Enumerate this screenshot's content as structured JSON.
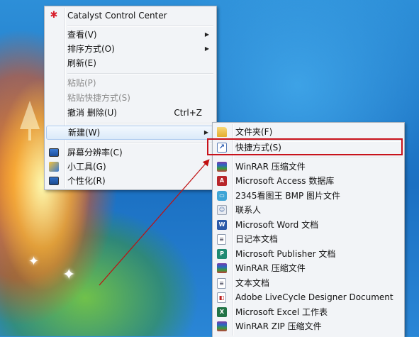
{
  "context_menu": {
    "items": [
      {
        "label": "Catalyst Control Center",
        "icon": "catalyst-icon"
      },
      {
        "label": "查看(V)",
        "submenu": true
      },
      {
        "label": "排序方式(O)",
        "submenu": true
      },
      {
        "label": "刷新(E)"
      },
      {
        "label": "粘贴(P)",
        "disabled": true
      },
      {
        "label": "粘贴快捷方式(S)",
        "disabled": true
      },
      {
        "label": "撤消 删除(U)",
        "shortcut": "Ctrl+Z"
      },
      {
        "label": "新建(W)",
        "submenu": true,
        "active": true
      },
      {
        "label": "屏幕分辨率(C)",
        "icon": "screen-resolution-icon"
      },
      {
        "label": "小工具(G)",
        "icon": "gadgets-icon"
      },
      {
        "label": "个性化(R)",
        "icon": "personalize-icon"
      }
    ]
  },
  "new_submenu": {
    "items": [
      {
        "label": "文件夹(F)",
        "icon": "folder-icon"
      },
      {
        "label": "快捷方式(S)",
        "icon": "shortcut-icon"
      },
      {
        "label": "WinRAR 压缩文件",
        "icon": "winrar-icon"
      },
      {
        "label": "Microsoft Access 数据库",
        "icon": "access-icon"
      },
      {
        "label": "2345看图王 BMP 图片文件",
        "icon": "bmp-image-icon"
      },
      {
        "label": "联系人",
        "icon": "contact-icon"
      },
      {
        "label": "Microsoft Word 文档",
        "icon": "word-icon"
      },
      {
        "label": "日记本文档",
        "icon": "journal-icon"
      },
      {
        "label": "Microsoft Publisher 文档",
        "icon": "publisher-icon"
      },
      {
        "label": "WinRAR 压缩文件",
        "icon": "winrar-icon"
      },
      {
        "label": "文本文档",
        "icon": "text-document-icon"
      },
      {
        "label": "Adobe LiveCycle Designer Document",
        "icon": "adobe-document-icon"
      },
      {
        "label": "Microsoft Excel 工作表",
        "icon": "excel-icon"
      },
      {
        "label": "WinRAR ZIP 压缩文件",
        "icon": "winrar-zip-icon"
      }
    ]
  },
  "colors": {
    "highlight_box": "#c8121b",
    "annotation_arrow": "#c01010",
    "desktop_blue": "#1b70c2"
  }
}
